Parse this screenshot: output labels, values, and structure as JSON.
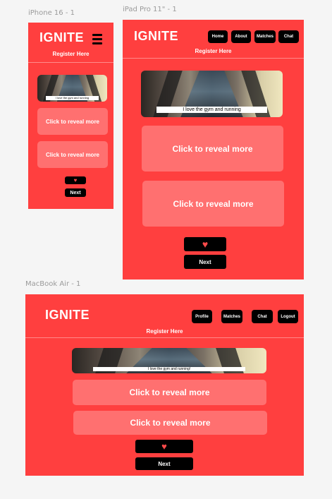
{
  "frames": {
    "phone": {
      "label": "iPhone 16 - 1",
      "logo": "IGNITE",
      "register": "Register Here",
      "caption": "I love the gym and running",
      "reveal_1": "Click to reveal more",
      "reveal_2": "Click to reveal more",
      "next": "Next"
    },
    "ipad": {
      "label": "iPad Pro 11\" - 1",
      "logo": "IGNITE",
      "register": "Register Here",
      "nav": [
        "Home",
        "About",
        "Matches",
        "Chat"
      ],
      "caption": "I love the gym and running",
      "reveal_1": "Click to reveal more",
      "reveal_2": "Click to reveal more",
      "next": "Next"
    },
    "macbook": {
      "label": "MacBook Air - 1",
      "logo": "IGNITE",
      "register": "Register Here",
      "nav": [
        "Profile",
        "Matches",
        "Chat",
        "Logout"
      ],
      "caption": "I love the gym and running!",
      "reveal_1": "Click to reveal more",
      "reveal_2": "Click to reveal more",
      "next": "Next"
    }
  },
  "icons": {
    "heart": "heart-icon",
    "menu": "hamburger-menu-icon"
  },
  "colors": {
    "background": "#f5f5f5",
    "frame": "#ff3f3f",
    "reveal_card": "#ff7070",
    "button": "#000000",
    "heart": "#ff4a4a"
  }
}
